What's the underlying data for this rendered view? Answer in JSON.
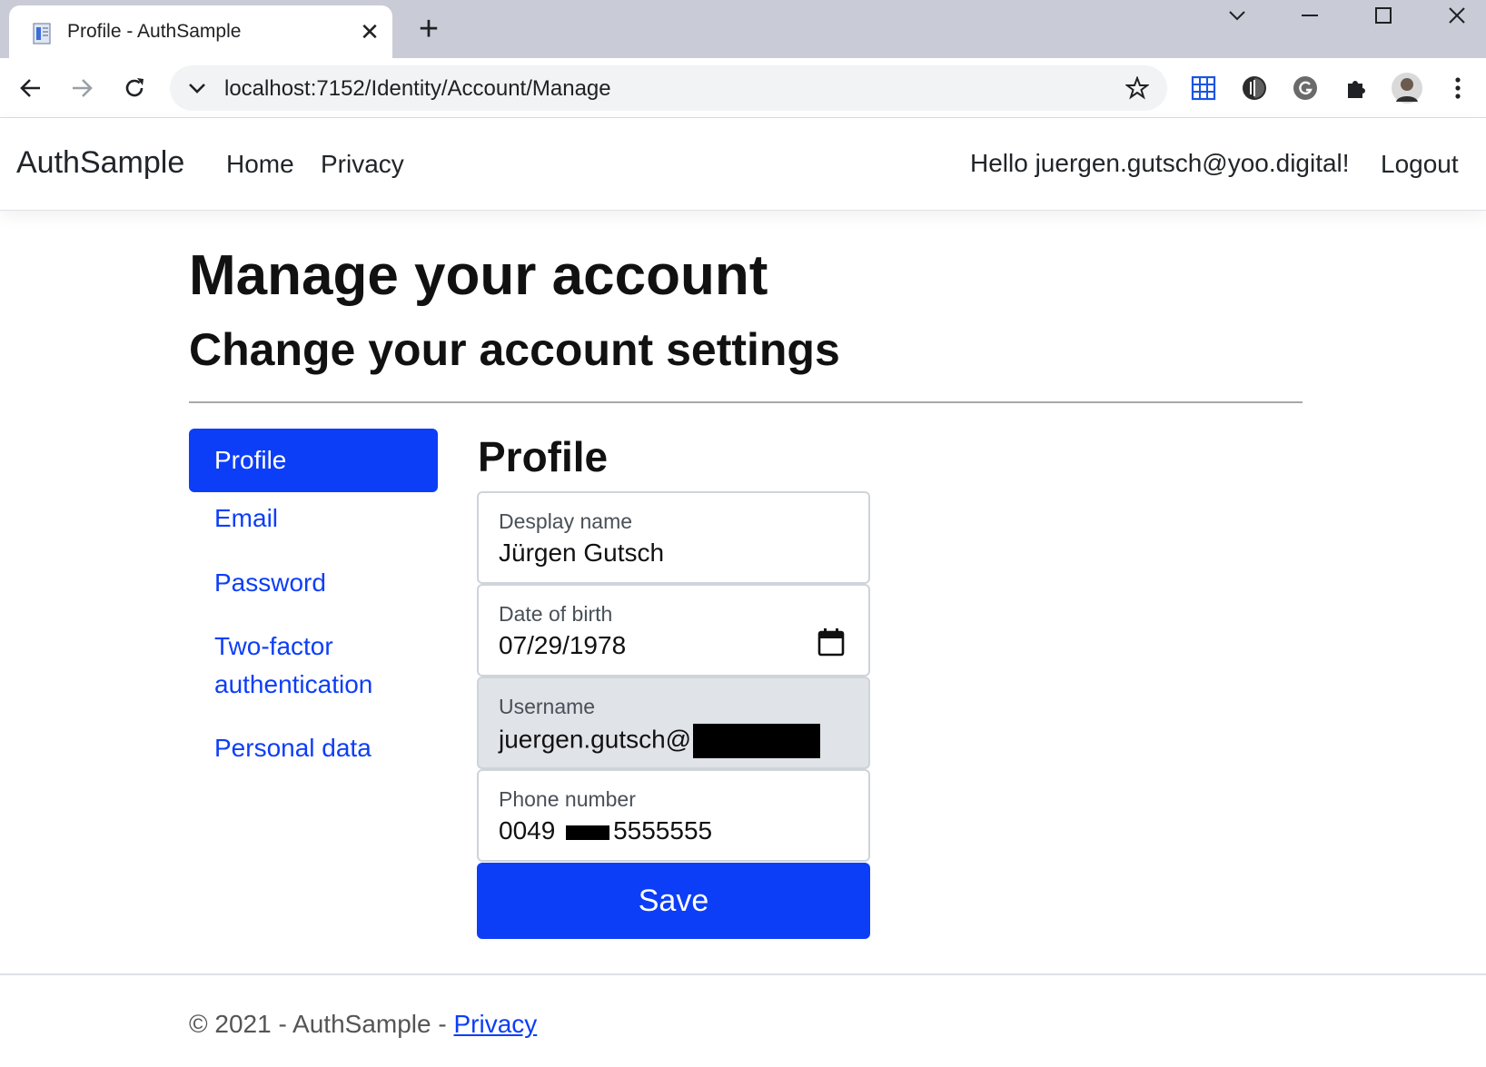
{
  "browser": {
    "tab_title": "Profile - AuthSample",
    "tab_close_glyph": "✕",
    "new_tab_glyph": "+",
    "url": "localhost:7152/Identity/Account/Manage"
  },
  "navbar": {
    "brand": "AuthSample",
    "links": [
      "Home",
      "Privacy"
    ],
    "greeting": "Hello juergen.gutsch@yoo.digital!",
    "logout": "Logout"
  },
  "page": {
    "title": "Manage your account",
    "subtitle": "Change your account settings"
  },
  "side_nav": {
    "items": [
      {
        "label": "Profile",
        "active": true
      },
      {
        "label": "Email",
        "active": false
      },
      {
        "label": "Password",
        "active": false
      },
      {
        "label": "Two-factor authentication",
        "active": false
      },
      {
        "label": "Personal data",
        "active": false
      }
    ]
  },
  "profile": {
    "heading": "Profile",
    "fields": {
      "display_name": {
        "label": "Desplay name",
        "value": "Jürgen Gutsch"
      },
      "date_of_birth": {
        "label": "Date of birth",
        "value": "07/29/1978"
      },
      "username": {
        "label": "Username",
        "value": "juergen.gutsch@"
      },
      "phone": {
        "label": "Phone number",
        "value_prefix": "0049",
        "value_suffix": "5555555"
      }
    },
    "save_label": "Save"
  },
  "footer": {
    "text": "© 2021 - AuthSample - ",
    "privacy_link": "Privacy"
  },
  "colors": {
    "primary": "#0d3ef7",
    "readonly_bg": "#e0e3e8",
    "tabstrip_bg": "#c9ccd6"
  }
}
